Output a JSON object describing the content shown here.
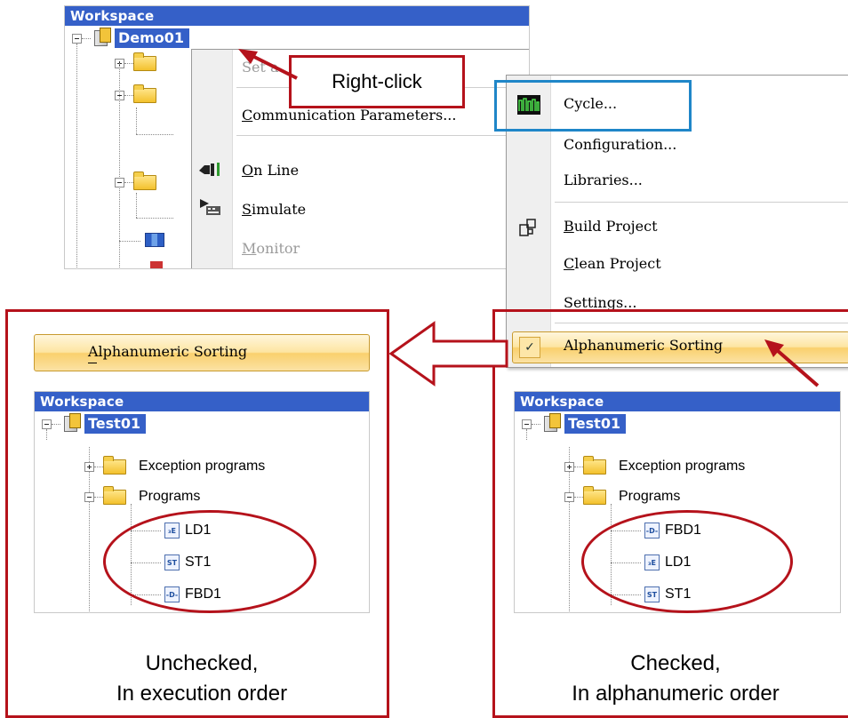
{
  "top_workspace": {
    "header": "Workspace",
    "project": "Demo01"
  },
  "context_menu_1": {
    "items": [
      {
        "label": "Set a",
        "state": "disabled",
        "cut": true
      },
      {
        "label": "Communication Parameters...",
        "underline": "C"
      },
      {
        "label": "On Line",
        "underline": "O",
        "icon": "online-icon"
      },
      {
        "label": "Simulate",
        "underline": "S",
        "icon": "simulate-icon"
      },
      {
        "label": "Monitor",
        "state": "disabled"
      }
    ]
  },
  "right_click_callout": "Right-click",
  "context_menu_2": {
    "items": [
      {
        "label": "Cycle...",
        "icon": "cycle-icon"
      },
      {
        "label": "Configuration..."
      },
      {
        "label": "Libraries..."
      },
      {
        "label": "Build Project",
        "icon": "build-icon"
      },
      {
        "label": "Clean Project"
      },
      {
        "label": "Settings..."
      },
      {
        "label": "Alphanumeric Sorting",
        "checked": true
      }
    ]
  },
  "alpha_sort_button": "Alphanumeric Sorting",
  "left_panel": {
    "header": "Workspace",
    "project": "Test01",
    "folders": [
      "Exception programs",
      "Programs"
    ],
    "programs": [
      {
        "name": "LD1",
        "type": "LD"
      },
      {
        "name": "ST1",
        "type": "ST"
      },
      {
        "name": "FBD1",
        "type": "FBD"
      }
    ],
    "caption_line1": "Unchecked,",
    "caption_line2": "In execution order"
  },
  "right_panel": {
    "header": "Workspace",
    "project": "Test01",
    "folders": [
      "Exception programs",
      "Programs"
    ],
    "programs": [
      {
        "name": "FBD1",
        "type": "FBD"
      },
      {
        "name": "LD1",
        "type": "LD"
      },
      {
        "name": "ST1",
        "type": "ST"
      }
    ],
    "caption_line1": "Checked,",
    "caption_line2": "In alphanumeric order"
  },
  "colors": {
    "accent_red": "#b5121b",
    "accent_blue": "#1f86c8",
    "workspace_blue": "#3560c8"
  }
}
